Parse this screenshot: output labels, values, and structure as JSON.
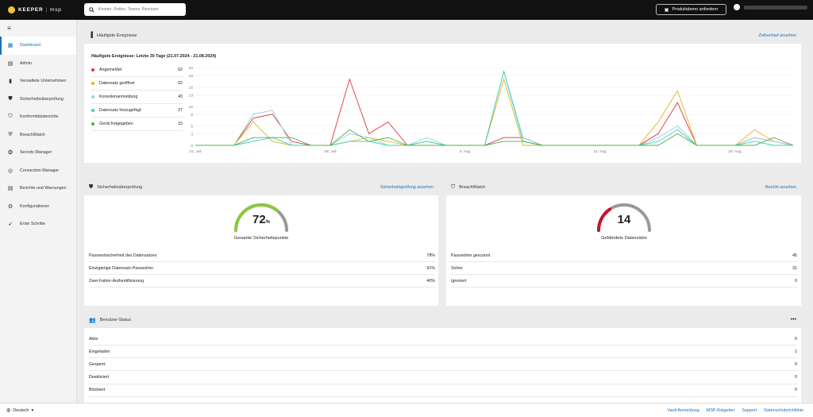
{
  "app": {
    "brand": "KEEPER",
    "brand_sub": "msp"
  },
  "search": {
    "placeholder": "Knoten, Rollen, Teams, Benutzer"
  },
  "header": {
    "demo_button": "Produktdemo anfordern"
  },
  "sidebar": {
    "items": [
      {
        "label": "Dashboard",
        "icon": "dashboard-icon",
        "active": true
      },
      {
        "label": "Admin",
        "icon": "admin-icon"
      },
      {
        "label": "Verwaltete Unternehmen",
        "icon": "building-icon"
      },
      {
        "label": "Sicherheitsüberprüfung",
        "icon": "shield-icon"
      },
      {
        "label": "Konformitätsberichte",
        "icon": "compliance-icon"
      },
      {
        "label": "BreachWatch",
        "icon": "breachwatch-icon"
      },
      {
        "label": "Secrets Manager",
        "icon": "secrets-icon"
      },
      {
        "label": "Connection Manager",
        "icon": "connection-icon"
      },
      {
        "label": "Berichte und Warnungen",
        "icon": "reports-icon"
      },
      {
        "label": "Konfigurationen",
        "icon": "gear-icon"
      },
      {
        "label": "Erste Schritte",
        "icon": "rocket-icon"
      }
    ]
  },
  "events": {
    "header": "Häufigste Ereignisse",
    "link": "Zeitverlauf ansehen",
    "subtitle": "Häufigste Ereignisse: Letzte 30 Tage (21.07.2024 - 21.08.2024)",
    "legend": [
      {
        "label": "Angemeldet",
        "count": "62",
        "color": "#d9363e"
      },
      {
        "label": "Datensatz geöffnet",
        "count": "52",
        "color": "#e6b422"
      },
      {
        "label": "Konsolenanmeldung",
        "count": "43",
        "color": "#8fd3e8"
      },
      {
        "label": "Datensatz hinzugefügt",
        "count": "27",
        "color": "#3ccfb4"
      },
      {
        "label": "Gerät freigegeben",
        "count": "15",
        "color": "#4caf50"
      }
    ]
  },
  "chart_data": {
    "type": "line",
    "x": [
      "21. Juli",
      "22",
      "23",
      "24",
      "25",
      "26",
      "27",
      "28. Juli",
      "29",
      "30",
      "31",
      "1",
      "2",
      "3",
      "4. Aug.",
      "5",
      "6",
      "7",
      "8",
      "9",
      "10",
      "11. Aug.",
      "12",
      "13",
      "14",
      "15",
      "16",
      "17",
      "18. Aug.",
      "19",
      "20",
      "21"
    ],
    "xticks": [
      "21. Juli",
      "28. Juli",
      "4. Aug.",
      "11. Aug.",
      "18. Aug."
    ],
    "yticks": [
      0,
      3,
      5,
      8,
      10,
      13,
      15,
      18,
      20
    ],
    "ylim": [
      0,
      20
    ],
    "series": [
      {
        "name": "Angemeldet",
        "color": "#d9363e",
        "values": [
          0,
          0,
          0,
          7,
          8,
          1,
          0,
          0,
          17,
          3,
          6,
          0,
          0,
          0,
          0,
          0,
          2,
          2,
          0,
          0,
          0,
          0,
          0,
          0,
          3,
          11,
          0,
          0,
          0,
          2,
          1,
          0
        ]
      },
      {
        "name": "Datensatz geöffnet",
        "color": "#e6b422",
        "values": [
          0,
          0,
          0,
          6,
          1,
          0,
          0,
          0,
          1,
          2,
          1,
          0,
          1,
          0,
          0,
          0,
          17,
          0,
          0,
          0,
          0,
          0,
          0,
          0,
          6,
          14,
          0,
          0,
          0,
          4,
          1,
          0
        ]
      },
      {
        "name": "Konsolenanmeldung",
        "color": "#8fd3e8",
        "values": [
          0,
          0,
          0,
          8,
          9,
          0,
          0,
          0,
          3,
          2,
          0,
          0,
          2,
          0,
          0,
          0,
          19,
          2,
          0,
          0,
          0,
          0,
          0,
          0,
          2,
          5,
          0,
          0,
          0,
          2,
          1,
          0
        ]
      },
      {
        "name": "Datensatz hinzugefügt",
        "color": "#3ccfb4",
        "values": [
          0,
          0,
          0,
          1,
          2,
          0,
          0,
          0,
          1,
          1,
          0,
          0,
          1,
          0,
          0,
          0,
          19,
          1,
          0,
          0,
          0,
          0,
          0,
          0,
          1,
          4,
          0,
          0,
          0,
          1,
          0,
          0
        ]
      },
      {
        "name": "Gerät freigegeben",
        "color": "#4caf50",
        "values": [
          0,
          0,
          0,
          2,
          2,
          2,
          0,
          0,
          4,
          1,
          2,
          0,
          0,
          0,
          0,
          0,
          1,
          1,
          0,
          0,
          0,
          0,
          0,
          0,
          0,
          3,
          0,
          0,
          0,
          0,
          2,
          0
        ]
      }
    ]
  },
  "security": {
    "header": "Sicherheitsüberprüfung",
    "link": "Sicherheitsprüfung ansehen",
    "score": "72",
    "score_unit": "%",
    "score_fraction": 0.72,
    "score_color": "#8dc63f",
    "score_label": "Gesamte Sicherheitspunkte",
    "rows": [
      {
        "label": "Passwortsicherheit des Datensatzes",
        "value": "78%"
      },
      {
        "label": "Einzigartige Datensatz-Passwörter",
        "value": "91%"
      },
      {
        "label": "Zwei-Faktor-Authentifizierung",
        "value": "40%"
      }
    ]
  },
  "breachwatch": {
    "header": "BreachWatch",
    "link": "Bericht ansehen",
    "count": "14",
    "at_risk_fraction": 0.31,
    "count_color": "#c8102e",
    "label": "Gefährdete Datensätze",
    "rows": [
      {
        "label": "Passwörter gescannt",
        "value": "45"
      },
      {
        "label": "Sicher",
        "value": "31"
      },
      {
        "label": "Ignoriert",
        "value": "0"
      }
    ]
  },
  "user_status": {
    "header": "Benutzer-Status",
    "menu": "•••",
    "rows": [
      {
        "label": "Aktiv",
        "value": "5"
      },
      {
        "label": "Eingeladen",
        "value": "1"
      },
      {
        "label": "Gesperrt",
        "value": "0"
      },
      {
        "label": "Deaktiviert",
        "value": "0"
      },
      {
        "label": "Blockiert",
        "value": "0"
      }
    ]
  },
  "footer": {
    "language": "Deutsch",
    "links": [
      "Vault Anmeldung",
      "MSP-Ratgeber",
      "Support",
      "Datenschutzrichtlinie"
    ]
  }
}
